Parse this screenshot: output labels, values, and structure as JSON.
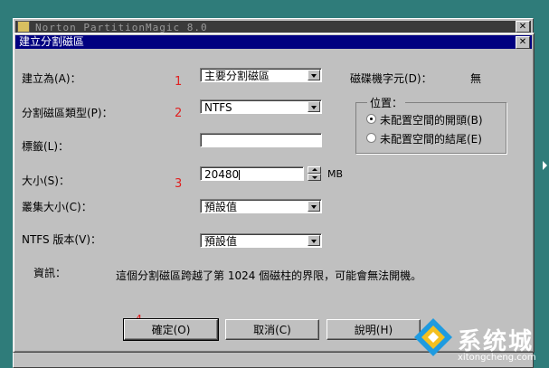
{
  "background_window": {
    "title": "Norton PartitionMagic 8.0",
    "close": "✕"
  },
  "dialog": {
    "title": "建立分割磁區",
    "close": "✕",
    "create_as": {
      "label": "建立為(A)：",
      "value": "主要分割磁區"
    },
    "partition_type": {
      "label": "分割磁區類型(P)：",
      "value": "NTFS"
    },
    "volume_label": {
      "label": "標籤(L)：",
      "value": ""
    },
    "size": {
      "label": "大小(S)：",
      "value": "20480",
      "unit": "MB"
    },
    "cluster_size": {
      "label": "叢集大小(C)：",
      "value": "預設值"
    },
    "ntfs_version": {
      "label": "NTFS 版本(V)：",
      "value": "預設值"
    },
    "drive_letter": {
      "label": "磁碟機字元(D)：",
      "value": "無"
    },
    "location": {
      "title": "位置：",
      "options": [
        "未配置空間的開頭(B)",
        "未配置空間的結尾(E)"
      ],
      "selected": 0
    },
    "info": {
      "label": "資訊：",
      "text": "這個分割磁區跨越了第 1024 個磁柱的界限，可能會無法開機。"
    },
    "buttons": {
      "ok": "確定(O)",
      "cancel": "取消(C)",
      "help": "說明(H)"
    }
  },
  "annotations": [
    "1",
    "2",
    "3",
    "4"
  ],
  "watermark": {
    "brand": "系统城",
    "url": "xitongcheng.com"
  },
  "colors": {
    "titlebar": "#000080",
    "dialog_bg": "#c0c0c0",
    "desktop": "#2f7c7a",
    "annotation": "#e02020"
  }
}
